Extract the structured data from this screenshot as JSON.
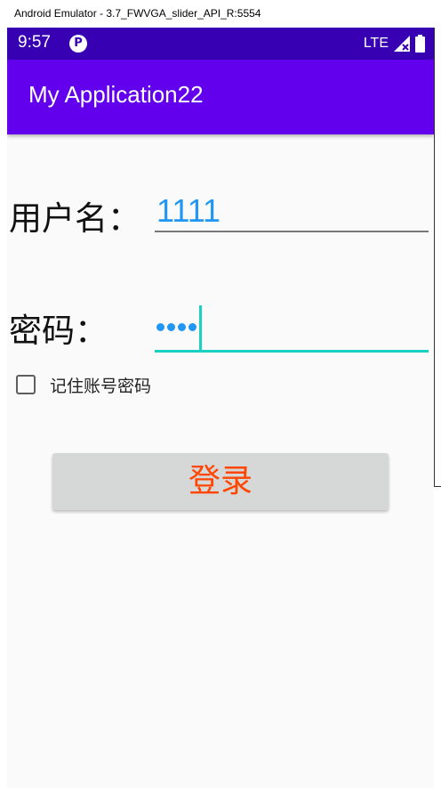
{
  "window": {
    "title": "Android Emulator - 3.7_FWVGA_slider_API_R:5554"
  },
  "status_bar": {
    "time": "9:57",
    "network": "LTE",
    "notification_icon": "circle-p-icon"
  },
  "app_bar": {
    "title": "My Application22"
  },
  "form": {
    "username_label": "用户名：",
    "username_value": "1111",
    "password_label": "密码：",
    "password_masked_length": 4,
    "remember_label": "记住账号密码",
    "remember_checked": false,
    "login_label": "登录"
  },
  "colors": {
    "status_bar": "#3700b3",
    "app_bar": "#6200ee",
    "input_text": "#2196f3",
    "focus_accent": "#1ad1c1",
    "button_bg": "#d6d7d7",
    "button_text": "#ff4500"
  }
}
